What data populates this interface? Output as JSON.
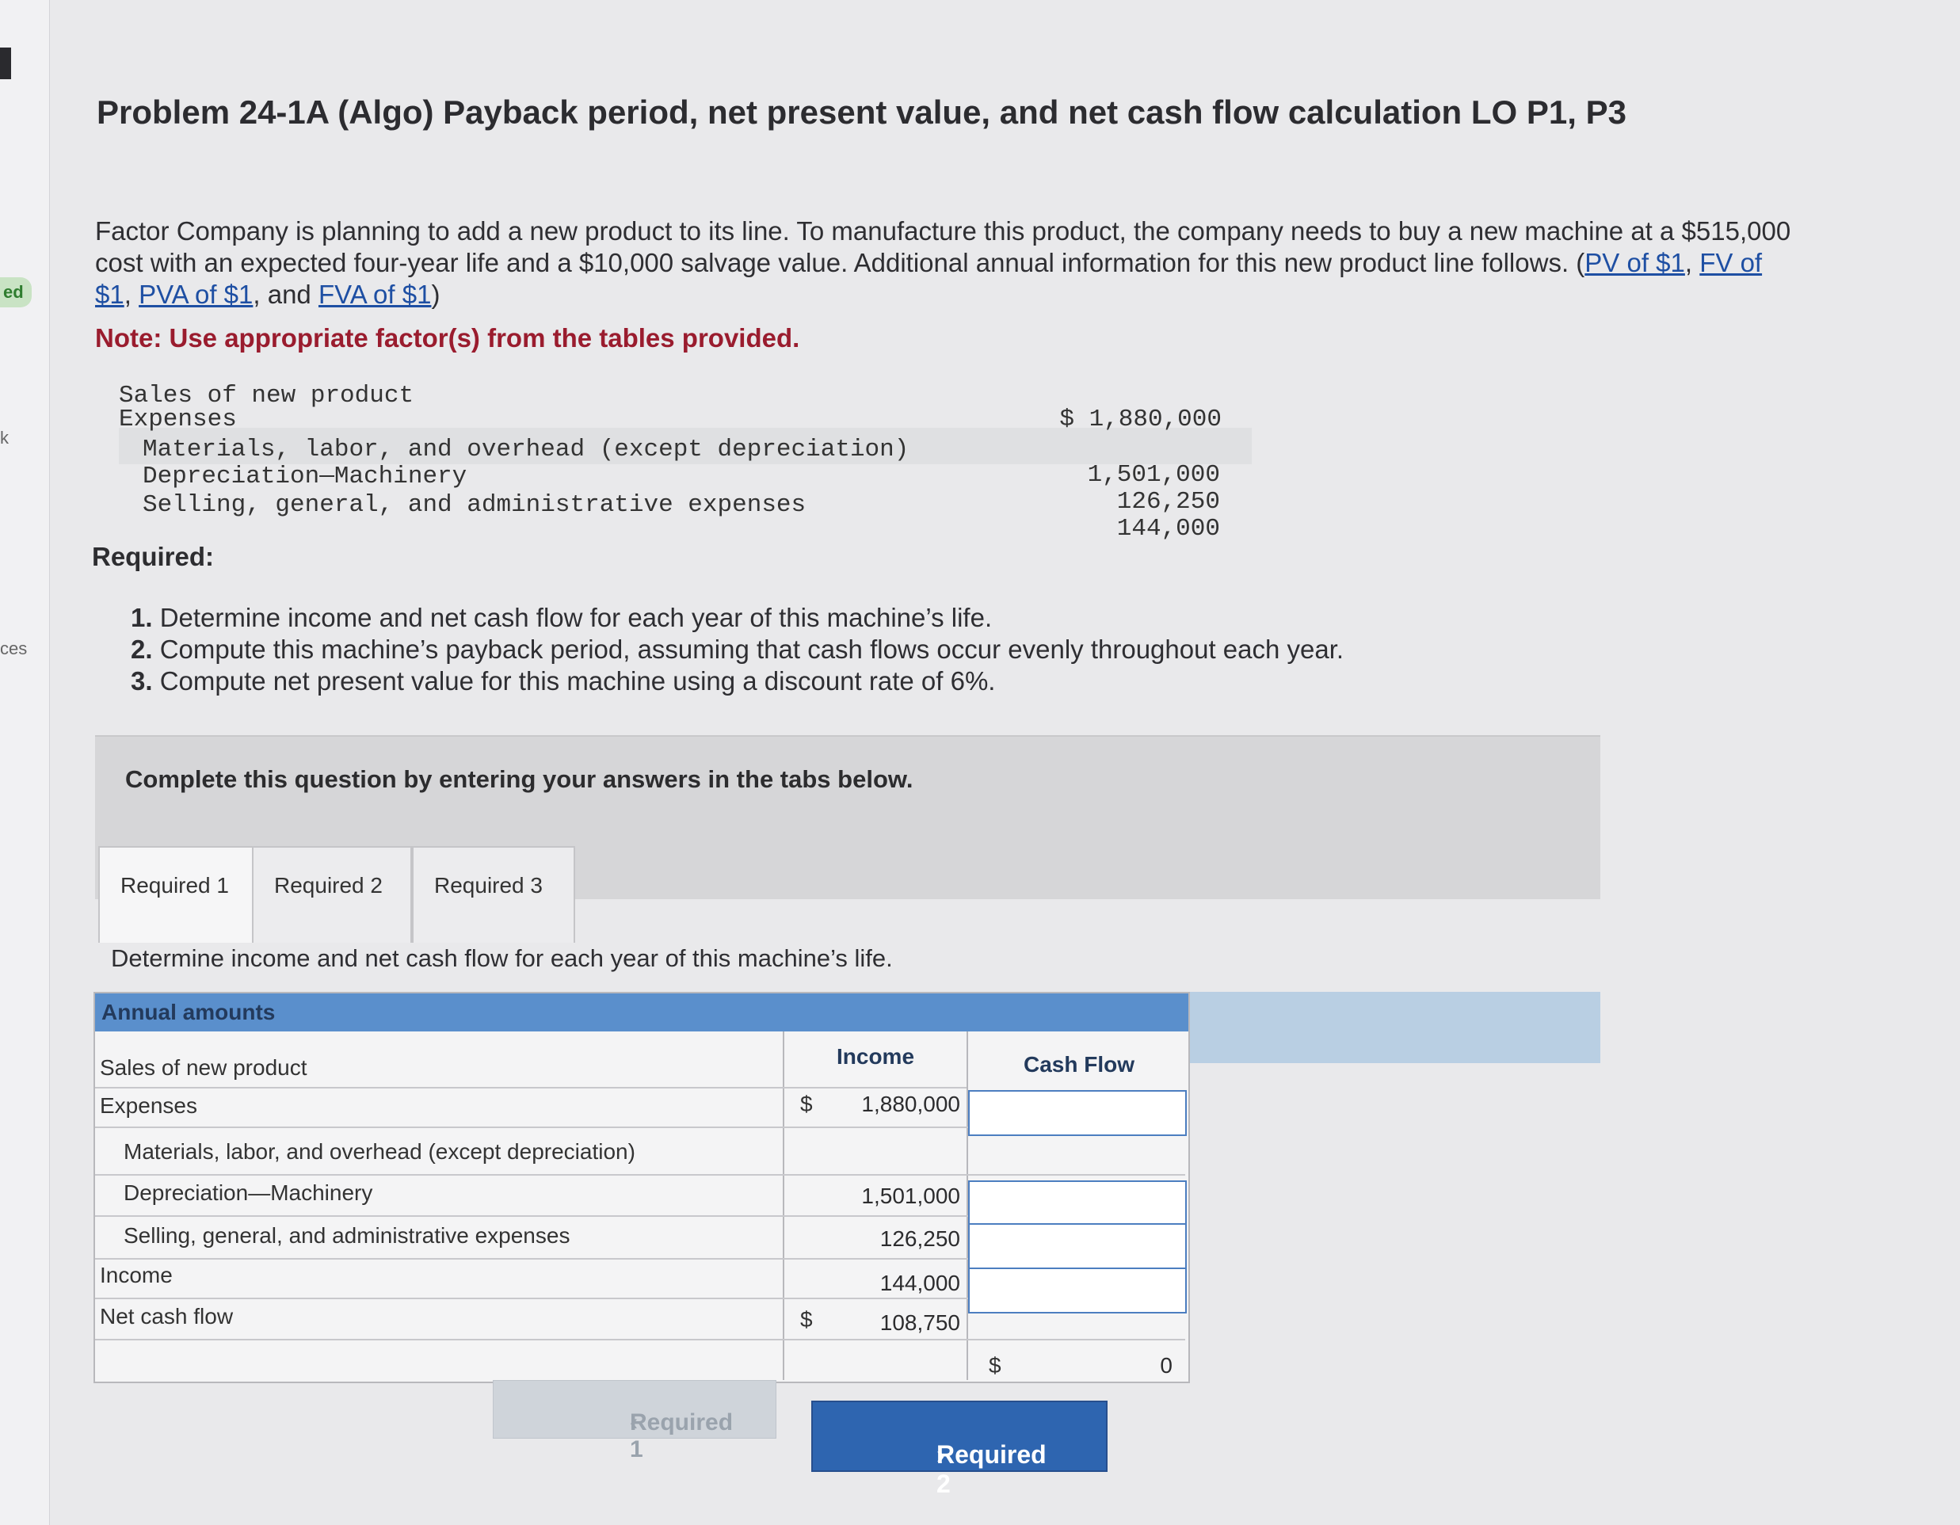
{
  "rail": {
    "tab1": "ed",
    "tab2": "k",
    "tab3": "ces"
  },
  "title": "Problem 24-1A (Algo) Payback period, net present value, and net cash flow calculation LO P1, P3",
  "intro": {
    "text": "Factor Company is planning to add a new product to its line. To manufacture this product, the company needs to buy a new machine at a $515,000 cost with an expected four-year life and a $10,000 salvage value. Additional annual information for this new product line follows.",
    "open_paren": "(",
    "link_pv": "PV of $1",
    "link_fv": "FV of $1",
    "link_pva": "PVA of $1",
    "link_fva": "FVA of $1",
    "sep": ", ",
    "and": ", and ",
    "close_paren": ")"
  },
  "note": "Note: Use appropriate factor(s) from the tables provided.",
  "data_table": {
    "sales_label": "Sales of new product",
    "expenses_label": "Expenses",
    "materials_label": "Materials, labor, and overhead (except depreciation)",
    "depreciation_label": "Depreciation—Machinery",
    "selling_label": "Selling, general, and administrative expenses",
    "sales_value": "$ 1,880,000",
    "materials_value": "1,501,000",
    "depreciation_value": "126,250",
    "selling_value": "144,000"
  },
  "required": {
    "heading": "Required:",
    "items": [
      {
        "num": "1.",
        "text": "Determine income and net cash flow for each year of this machine’s life."
      },
      {
        "num": "2.",
        "text": "Compute this machine’s payback period, assuming that cash flows occur evenly throughout each year."
      },
      {
        "num": "3.",
        "text": "Compute net present value for this machine using a discount rate of 6%."
      }
    ]
  },
  "panel_text": "Complete this question by entering your answers in the tabs below.",
  "tabs": [
    "Required 1",
    "Required 2",
    "Required 3"
  ],
  "instruction": "Determine income and net cash flow for each year of this machine’s life.",
  "answer_table": {
    "header": "Annual amounts",
    "col_income": "Income",
    "col_cash": "Cash Flow",
    "rows": {
      "sales": "Sales of new product",
      "expenses": "Expenses",
      "materials": "Materials, labor, and overhead (except depreciation)",
      "depreciation": "Depreciation—Machinery",
      "selling": "Selling, general, and administrative expenses",
      "income": "Income",
      "net_cash_flow": "Net cash flow"
    },
    "values": {
      "currency": "$",
      "sales_income": "1,880,000",
      "materials_income": "1,501,000",
      "depreciation_income": "126,250",
      "selling_income": "144,000",
      "income_income": "108,750",
      "net_cash_flow_cash": "0"
    }
  },
  "nav": {
    "prev": "Required 1",
    "next": "Required 2",
    "prev_icon": "‹",
    "next_icon": "›"
  }
}
